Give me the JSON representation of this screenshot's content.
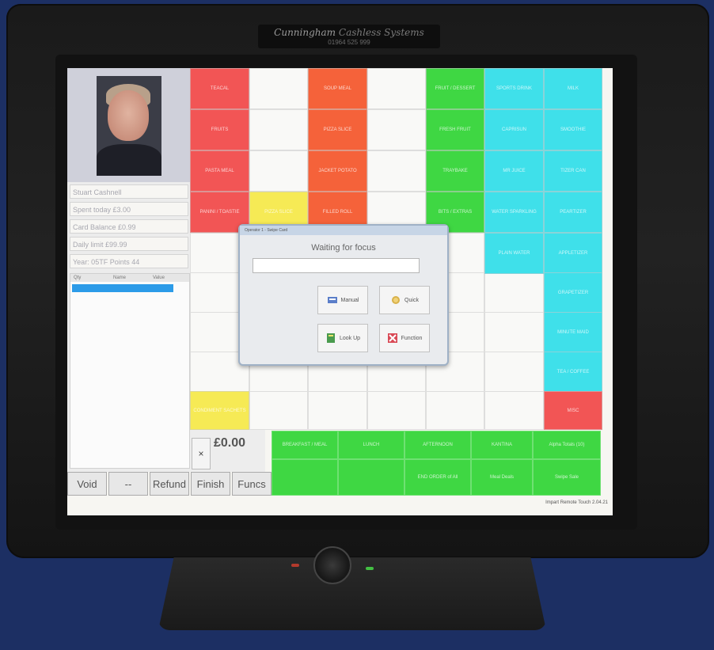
{
  "brand": {
    "name": "Cunningham",
    "subtitle": "Cashless Systems",
    "phone": "01964 525 999"
  },
  "customer": {
    "name": "Stuart Cashnell",
    "spent_today": "Spent today £3.00",
    "card_balance": "Card Balance £0.99",
    "daily_limit": "Daily limit £99.99",
    "year_points": "Year: 05TF  Points 44"
  },
  "order_list": {
    "headers": [
      "Qty",
      "Name",
      "Value"
    ]
  },
  "grid": {
    "cells": [
      {
        "label": "TEACAL",
        "color": "#f25555"
      },
      {
        "label": "",
        "color": "#f9f9f7"
      },
      {
        "label": "SOUP MEAL",
        "color": "#f5623a"
      },
      {
        "label": "",
        "color": "#f9f9f7"
      },
      {
        "label": "FRUIT / DESSERT",
        "color": "#3fd743"
      },
      {
        "label": "SPORTS DRINK",
        "color": "#3fe0ea"
      },
      {
        "label": "MILK",
        "color": "#3fe0ea"
      },
      {
        "label": "FRUITS",
        "color": "#f25555"
      },
      {
        "label": "",
        "color": "#f9f9f7"
      },
      {
        "label": "PIZZA SLICE",
        "color": "#f5623a"
      },
      {
        "label": "",
        "color": "#f9f9f7"
      },
      {
        "label": "FRESH FRUIT",
        "color": "#3fd743"
      },
      {
        "label": "CAPRISUN",
        "color": "#3fe0ea"
      },
      {
        "label": "SMOOTHIE",
        "color": "#3fe0ea"
      },
      {
        "label": "PASTA MEAL",
        "color": "#f25555"
      },
      {
        "label": "",
        "color": "#f9f9f7"
      },
      {
        "label": "JACKET POTATO",
        "color": "#f5623a"
      },
      {
        "label": "",
        "color": "#f9f9f7"
      },
      {
        "label": "TRAYBAKE",
        "color": "#3fd743"
      },
      {
        "label": "MR JUICE",
        "color": "#3fe0ea"
      },
      {
        "label": "TIZER CAN",
        "color": "#3fe0ea"
      },
      {
        "label": "PANINI / TOASTIE",
        "color": "#f25555"
      },
      {
        "label": "PIZZA SLICE",
        "color": "#f6ea55"
      },
      {
        "label": "FILLED ROLL",
        "color": "#f5623a"
      },
      {
        "label": "",
        "color": "#f9f9f7"
      },
      {
        "label": "BITS / EXTRAS",
        "color": "#3fd743"
      },
      {
        "label": "WATER SPARKLING",
        "color": "#3fe0ea"
      },
      {
        "label": "PEARTIZER",
        "color": "#3fe0ea"
      },
      {
        "label": "PLAIN WATER",
        "color": "#3fe0ea"
      },
      {
        "label": "APPLETIZER",
        "color": "#3fe0ea"
      },
      {
        "label": "GRAPETIZER",
        "color": "#3fe0ea"
      },
      {
        "label": "MINUTE MAID",
        "color": "#3fe0ea"
      },
      {
        "label": "TEA / COFFEE",
        "color": "#3fe0ea"
      },
      {
        "label": "CONDIMENT SACHETS",
        "color": "#f6ea55"
      },
      {
        "label": "MISC",
        "color": "#f25555"
      }
    ]
  },
  "dialog": {
    "title": "Operator 1 - Swipe Card",
    "caption": "Waiting for focus",
    "buttons": {
      "manual": "Manual",
      "quick": "Quick",
      "lookup": "Look Up",
      "function": "Function"
    }
  },
  "totals": {
    "close": "×",
    "amount": "£0.00"
  },
  "menu_bar": {
    "items": [
      "BREAKFAST / MEAL",
      "LUNCH",
      "AFTERNOON",
      "KANTINA",
      "Alpha Totals (10)",
      "",
      "",
      "END ORDER of All",
      "Meal Deals",
      "Swipe Sale"
    ]
  },
  "function_buttons": [
    "Void",
    "--",
    "Refund",
    "Finish",
    "Funcs"
  ],
  "footer": "Impart Remote Touch 2.04.21"
}
